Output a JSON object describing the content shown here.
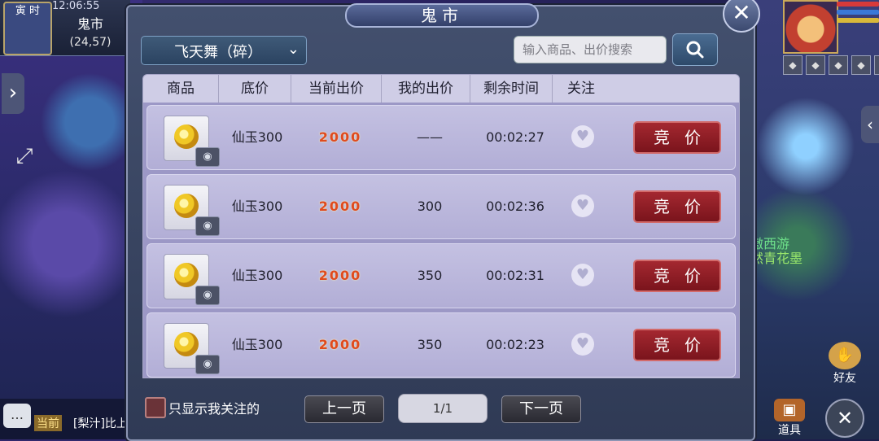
{
  "hud": {
    "time_badge": "寅 时",
    "clock": "12:06:55",
    "location": "鬼市",
    "coords": "(24,57)",
    "chat_channel": "当前",
    "chat_text": "[梨汁]比上",
    "npc_line1": "傲西游",
    "npc_line2": "然青花墨",
    "friend_label": "好友",
    "bag_label": "道具"
  },
  "market": {
    "title": "鬼市",
    "category": "飞天舞（碎）",
    "search_placeholder": "输入商品、出价搜索",
    "columns": [
      "商品",
      "底价",
      "当前出价",
      "我的出价",
      "剩余时间",
      "关注"
    ],
    "rows": [
      {
        "base_price": "仙玉300",
        "current_bid": "2000",
        "my_bid": "——",
        "time_left": "00:02:27",
        "bid_label": "竞价"
      },
      {
        "base_price": "仙玉300",
        "current_bid": "2000",
        "my_bid": "300",
        "time_left": "00:02:36",
        "bid_label": "竞价"
      },
      {
        "base_price": "仙玉300",
        "current_bid": "2000",
        "my_bid": "350",
        "time_left": "00:02:31",
        "bid_label": "竞价"
      },
      {
        "base_price": "仙玉300",
        "current_bid": "2000",
        "my_bid": "350",
        "time_left": "00:02:23",
        "bid_label": "竞价"
      }
    ],
    "watch_only_label": "只显示我关注的",
    "prev_label": "上一页",
    "page": "1/1",
    "next_label": "下一页"
  },
  "colors": {
    "bid_button": "#8e1c24",
    "current_bid_text": "#e04a1e",
    "header_bg": "#cfcde6"
  },
  "icons": [
    "search-icon",
    "close-icon",
    "chevron-down-icon",
    "eye-icon",
    "heart-icon",
    "chat-icon",
    "fullscreen-icon"
  ]
}
